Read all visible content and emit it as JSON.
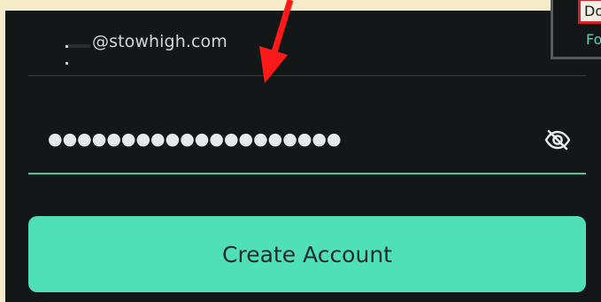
{
  "form": {
    "email_value": "@stowhigh.com",
    "password_value": "●●●●●●●●●●●●●●●●●●●●",
    "submit_label": "Create Account"
  },
  "popup": {
    "item_top_label": "Do",
    "item_bottom_label": "Fo"
  },
  "icons": {
    "toggle_visibility": "eye-slash-icon",
    "annotation": "red-arrow-annotation"
  },
  "colors": {
    "accent": "#4fe0b7",
    "underline": "#4dc7a4",
    "background": "#141718",
    "annotation": "#ff0000"
  }
}
